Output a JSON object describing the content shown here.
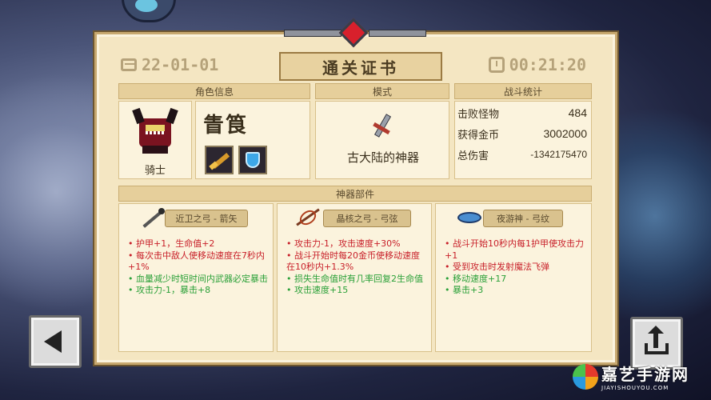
{
  "certificate": {
    "title": "通关证书",
    "date": "22-01-01",
    "time": "00:21:20"
  },
  "sections": {
    "role_info": "角色信息",
    "mode": "模式",
    "battle_stats": "战斗统计",
    "artifact_parts": "神器部件"
  },
  "role": {
    "character": "骑士",
    "player_name": "眚筤",
    "items": [
      "weapon-icon",
      "shield-buff-icon"
    ]
  },
  "mode": {
    "name": "古大陆的神器"
  },
  "stats": [
    {
      "label": "击败怪物",
      "value": "484"
    },
    {
      "label": "获得金币",
      "value": "3002000"
    },
    {
      "label": "总伤害",
      "value": "-1342175470"
    }
  ],
  "parts": [
    {
      "name": "近卫之弓 - 箭矢",
      "effects": [
        {
          "text": "护甲+1，生命值+2",
          "color": "red"
        },
        {
          "text": "每次击中敌人使移动速度在7秒内+1%",
          "color": "red"
        },
        {
          "text": "血量减少时短时间内武器必定暴击",
          "color": "green"
        },
        {
          "text": "攻击力-1，暴击+8",
          "color": "green"
        }
      ]
    },
    {
      "name": "晶核之弓 - 弓弦",
      "effects": [
        {
          "text": "攻击力-1，攻击速度+30%",
          "color": "red"
        },
        {
          "text": "战斗开始时每20金币使移动速度在10秒内+1.3%",
          "color": "red"
        },
        {
          "text": "损失生命值时有几率回复2生命值",
          "color": "green"
        },
        {
          "text": "攻击速度+15",
          "color": "green"
        }
      ]
    },
    {
      "name": "夜游神 - 弓纹",
      "effects": [
        {
          "text": "战斗开始10秒内每1护甲使攻击力+1",
          "color": "red"
        },
        {
          "text": "受到攻击时发射魔法飞弹",
          "color": "red"
        },
        {
          "text": "移动速度+17",
          "color": "green"
        },
        {
          "text": "暴击+3",
          "color": "green"
        }
      ]
    }
  ],
  "buttons": {
    "back": "back-arrow-icon",
    "share": "share-upload-icon"
  },
  "watermark": {
    "cn": "嘉艺手游网",
    "en": "JIAYISHOUYOU.COM"
  },
  "colors": {
    "effect_red": "#c8202a",
    "effect_green": "#2aa038",
    "parchment": "#f4e6c2"
  }
}
